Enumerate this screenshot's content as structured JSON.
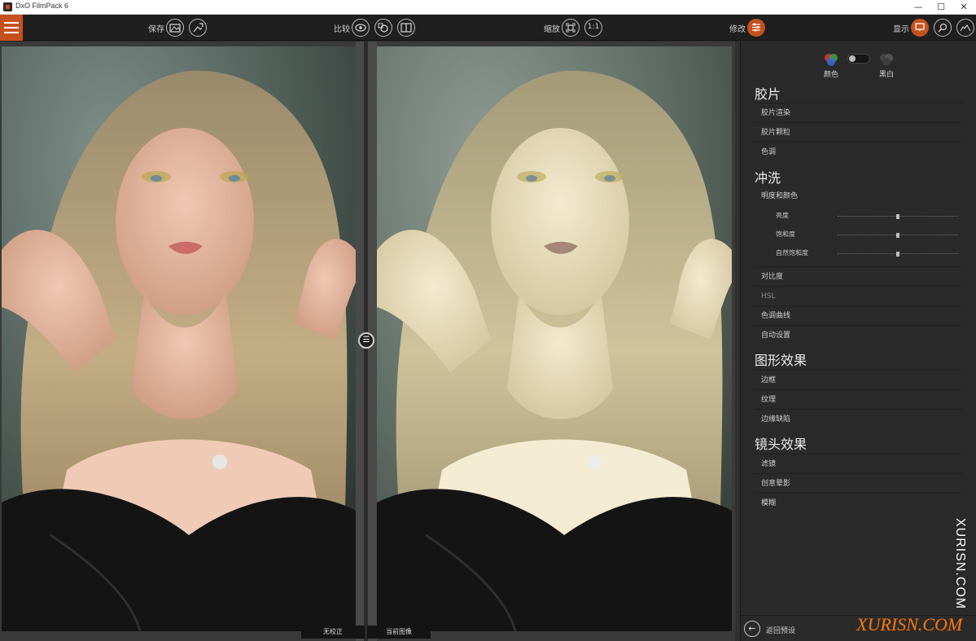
{
  "window": {
    "title": "DxO FilmPack 6",
    "minimize": "—",
    "maximize": "☐",
    "close": "✕"
  },
  "toolbar": {
    "save_label": "保存",
    "compare_label": "比较",
    "zoom_label": "缩放",
    "zoom_1to1": "1:1",
    "edit_label": "修改",
    "display_label": "显示"
  },
  "viewer": {
    "left_caption": "无校正",
    "right_caption": "当前图像"
  },
  "panel": {
    "mode_color": "颜色",
    "mode_bw": "黑白",
    "sections": [
      {
        "title": "胶片",
        "items": [
          "胶片渲染",
          "胶片颗粒",
          "色调"
        ]
      },
      {
        "title": "冲洗",
        "items": [
          "明度和颜色",
          "对比度",
          "HSL",
          "色调曲线",
          "自动设置"
        ]
      },
      {
        "title": "图形效果",
        "items": [
          "边框",
          "纹理",
          "边缘缺陷"
        ]
      },
      {
        "title": "镜头效果",
        "items": [
          "滤镜",
          "创意晕影",
          "模糊"
        ]
      }
    ],
    "sliders": [
      {
        "label": "亮度",
        "value": 0
      },
      {
        "label": "饱和度",
        "value": 0
      },
      {
        "label": "自然饱和度",
        "value": 0
      }
    ],
    "back_label": "返回预设"
  },
  "watermark": {
    "vertical": "XURISN.COM",
    "horizontal": "XURISN.COM"
  },
  "colors": {
    "accent": "#c4521f",
    "toolbar": "#1f1f1f",
    "panel": "#2a2a2a",
    "viewer": "#3a3a3a"
  },
  "icons": [
    "menu-icon",
    "save-image-icon",
    "export-icon",
    "eye-icon",
    "compare-icon",
    "split-compare-icon",
    "zoom-fit-icon",
    "sliders-icon",
    "display-icon",
    "loupe-icon",
    "histogram-icon",
    "color-circles-icon",
    "toggle-icon",
    "back-arrow-icon"
  ]
}
